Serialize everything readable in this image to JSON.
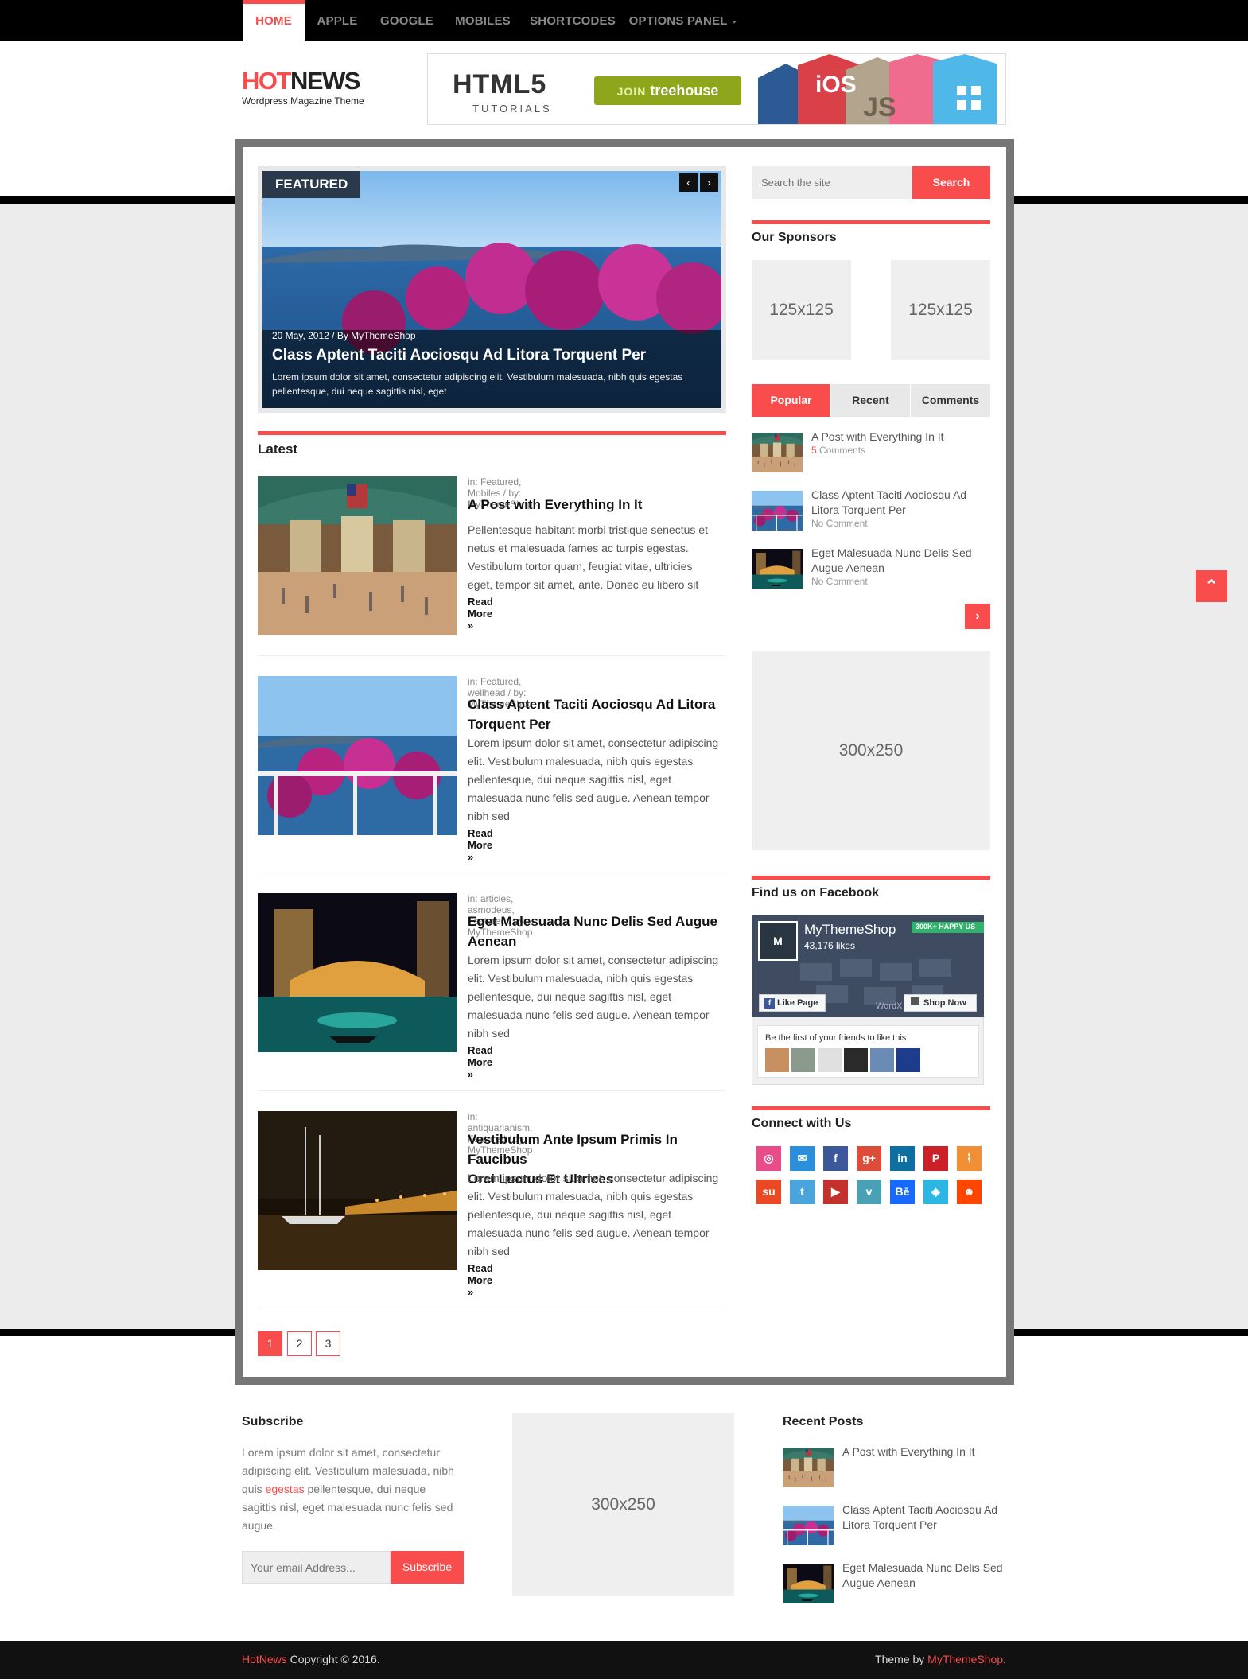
{
  "nav": {
    "items": [
      {
        "label": "HOME",
        "active": true
      },
      {
        "label": "APPLE"
      },
      {
        "label": "GOOGLE"
      },
      {
        "label": "MOBILES"
      },
      {
        "label": "SHORTCODES"
      },
      {
        "label": "OPTIONS PANEL"
      }
    ]
  },
  "header": {
    "logo_red": "HOT",
    "logo_dark": "NEWS",
    "tagline": "Wordpress Magazine Theme"
  },
  "banner": {
    "title": "HTML5",
    "subtitle": "TUTORIALS",
    "cta_join": "JOIN",
    "cta_brand": "treehouse",
    "badge_ios": "iOS",
    "badge_js": "JS"
  },
  "featured": {
    "label": "FEATURED",
    "meta": "20 May, 2012 / By MyThemeShop",
    "title": "Class Aptent Taciti Aociosqu Ad Litora Torquent Per",
    "excerpt": "Lorem ipsum dolor sit amet, consectetur adipiscing elit. Vestibulum malesuada, nibh quis egestas pellentesque, dui neque sagittis nisl, eget"
  },
  "latest": {
    "title": "Latest",
    "read_more": "Read More »",
    "posts": [
      {
        "meta": "in: Featured, Mobiles / by: MyThemeShop",
        "title_l1": "A Post with Everything In It",
        "title_l2": "",
        "excerpt_lines": [
          "Pellentesque habitant morbi tristique senectus et",
          "netus et malesuada fames ac turpis egestas.",
          "Vestibulum tortor quam, feugiat vitae, ultricies",
          "eget, tempor sit amet, ante. Donec eu libero sit",
          ""
        ]
      },
      {
        "meta": "in: Featured, wellhead / by: MyThemeShop",
        "title_l1": "Class Aptent Taciti Aociosqu Ad Litora",
        "title_l2": "Torquent Per",
        "excerpt_lines": [
          "Lorem ipsum dolor sit amet, consectetur adipiscing",
          "elit. Vestibulum malesuada, nibh quis egestas",
          "pellentesque, dui neque sagittis nisl, eget",
          "malesuada nunc felis sed augue. Aenean tempor",
          "nibh sed"
        ]
      },
      {
        "meta": "in: articles, asmodeus, Featured / by: MyThemeShop",
        "title_l1": "Eget Malesuada Nunc Delis Sed Augue",
        "title_l2": "Aenean",
        "excerpt_lines": [
          "Lorem ipsum dolor sit amet, consectetur adipiscing",
          "elit. Vestibulum malesuada, nibh quis egestas",
          "pellentesque, dui neque sagittis nisl, eget",
          "malesuada nunc felis sed augue. Aenean tempor",
          "nibh sed"
        ]
      },
      {
        "meta": "in: antiquarianism, Featured / by: MyThemeShop",
        "title_l1": "Vestibulum Ante Ipsum Primis In Faucibus",
        "title_l2": "Orci Luctus Et Ultrices",
        "excerpt_lines": [
          "Lorem ipsum dolor sit amet, consectetur adipiscing",
          "elit. Vestibulum malesuada, nibh quis egestas",
          "pellentesque, dui neque sagittis nisl, eget",
          "malesuada nunc felis sed augue. Aenean tempor",
          "nibh sed"
        ]
      }
    ]
  },
  "pagination": [
    "1",
    "2",
    "3"
  ],
  "sidebar": {
    "search_placeholder": "Search the site",
    "search_button": "Search",
    "sponsors_title": "Our Sponsors",
    "sponsor_ad_1": "125x125",
    "sponsor_ad_2": "125x125",
    "tabs": [
      "Popular",
      "Recent",
      "Comments"
    ],
    "tab_posts": [
      {
        "title_l1": "A Post with Everything In It",
        "title_l2": "",
        "comments_num": "5",
        "comments_label": " Comments"
      },
      {
        "title_l1": "Class Aptent Taciti Aociosqu Ad",
        "title_l2": "Litora Torquent Per",
        "comments_num": "",
        "comments_label": "No Comment"
      },
      {
        "title_l1": "Eget Malesuada Nunc Delis Sed",
        "title_l2": "Augue Aenean",
        "comments_num": "",
        "comments_label": "No Comment"
      }
    ],
    "ad_300": "300x250",
    "facebook_title": "Find us on Facebook",
    "fb_page_name": "MyThemeShop",
    "fb_likes": "43,176 likes",
    "fb_banner": "300K+ HAPPY US",
    "fb_wordmark": "WordX",
    "fb_like_btn": "Like Page",
    "fb_shop_btn": "Shop Now",
    "fb_friends_text": "Be the first of your friends to like this",
    "connect_title": "Connect with Us",
    "social_icons": [
      {
        "name": "dribbble",
        "glyph": "◎",
        "color": "#ea4c89"
      },
      {
        "name": "email",
        "glyph": "✉",
        "color": "#2c8fdc"
      },
      {
        "name": "facebook",
        "glyph": "f",
        "color": "#3b5998"
      },
      {
        "name": "google-plus",
        "glyph": "g+",
        "color": "#dd4b39"
      },
      {
        "name": "linkedin",
        "glyph": "in",
        "color": "#0e6fa3"
      },
      {
        "name": "pinterest",
        "glyph": "P",
        "color": "#cb2027"
      },
      {
        "name": "rss",
        "glyph": "⌇",
        "color": "#f18f36"
      },
      {
        "name": "stumbleupon",
        "glyph": "su",
        "color": "#eb4924"
      },
      {
        "name": "twitter",
        "glyph": "t",
        "color": "#4aa4de"
      },
      {
        "name": "youtube",
        "glyph": "▶",
        "color": "#c4302b"
      },
      {
        "name": "vimeo",
        "glyph": "v",
        "color": "#4aa0b5"
      },
      {
        "name": "behance",
        "glyph": "Bē",
        "color": "#1769ff"
      },
      {
        "name": "delicious",
        "glyph": "◈",
        "color": "#2bb6e4"
      },
      {
        "name": "reddit",
        "glyph": "☻",
        "color": "#ff4500"
      }
    ]
  },
  "footer_widgets": {
    "subscribe_title": "Subscribe",
    "subscribe_lines": [
      "Lorem ipsum dolor sit amet, consectetur",
      "adipiscing elit. Vestibulum malesuada, nibh",
      "quis ",
      "egestas",
      " pellentesque, dui neque",
      "sagittis nisl, eget malesuada nunc felis sed",
      "augue."
    ],
    "email_placeholder": "Your email Address...",
    "subscribe_button": "Subscribe",
    "ad_300": "300x250",
    "recent_title": "Recent Posts",
    "recent_posts": [
      {
        "l1": "A Post with Everything In It",
        "l2": ""
      },
      {
        "l1": "Class Aptent Taciti Aociosqu Ad",
        "l2": "Litora Torquent Per"
      },
      {
        "l1": "Eget Malesuada Nunc Delis Sed",
        "l2": "Augue Aenean"
      }
    ]
  },
  "footer": {
    "brand": "HotNews",
    "copyright": " Copyright © 2016.",
    "theme_by": "Theme by ",
    "theme_link": "MyThemeShop",
    "period": "."
  },
  "colors": {
    "accent": "#f94c4c",
    "nav_bg": "#000000",
    "frame": "#767676",
    "page_bg": "#ececec"
  }
}
